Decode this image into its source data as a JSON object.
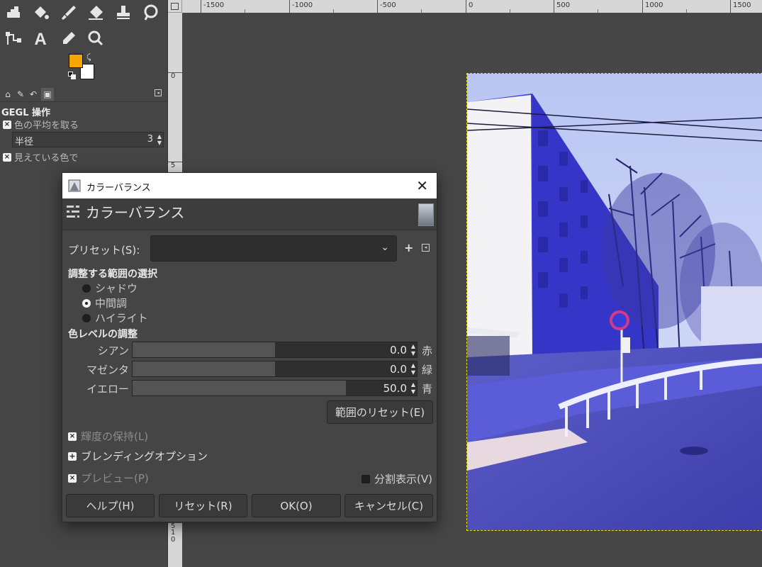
{
  "toolbox": {
    "tools": [
      "move-tool",
      "bucket-fill-tool",
      "paintbrush-tool",
      "eraser-tool",
      "clone-tool",
      "smudge-tool",
      "paths-tool",
      "text-tool",
      "color-picker-tool",
      "zoom-tool"
    ],
    "fg_color": "#f7a600",
    "bg_color": "#ffffff"
  },
  "tool_options": {
    "title": "GEGL 操作",
    "sample_average_label": "色の平均を取る",
    "radius_label": "半径",
    "radius_value": "3",
    "sample_merged_label": "見えている色で"
  },
  "rulers": {
    "horizontal": [
      "-1500",
      "-1000",
      "-500",
      "0",
      "500",
      "1000",
      "1500"
    ],
    "vertical": [
      "0",
      "5",
      "5",
      "1",
      "0",
      "1",
      "5",
      "0"
    ]
  },
  "dialog": {
    "window_title": "カラーバランス",
    "header_title": "カラーバランス",
    "preset_label": "プリセット(S):",
    "preset_value": "",
    "range_section": "調整する範囲の選択",
    "ranges": [
      {
        "label": "シャドウ",
        "selected": false
      },
      {
        "label": "中間調",
        "selected": true
      },
      {
        "label": "ハイライト",
        "selected": false
      }
    ],
    "levels_section": "色レベルの調整",
    "sliders": [
      {
        "left": "シアン",
        "right": "赤",
        "value": "0.0",
        "fraction": 0.5
      },
      {
        "left": "マゼンタ",
        "right": "緑",
        "value": "0.0",
        "fraction": 0.5
      },
      {
        "left": "イエロー",
        "right": "青",
        "value": "50.0",
        "fraction": 0.75
      }
    ],
    "reset_range_button": "範囲のリセット(E)",
    "preserve_luminosity": "輝度の保持(L)",
    "blending_options": "ブレンディングオプション",
    "preview": "プレビュー(P)",
    "split_view": "分割表示(V)",
    "buttons": {
      "help": "ヘルプ(H)",
      "reset": "リセット(R)",
      "ok": "OK(O)",
      "cancel": "キャンセル(C)"
    }
  }
}
